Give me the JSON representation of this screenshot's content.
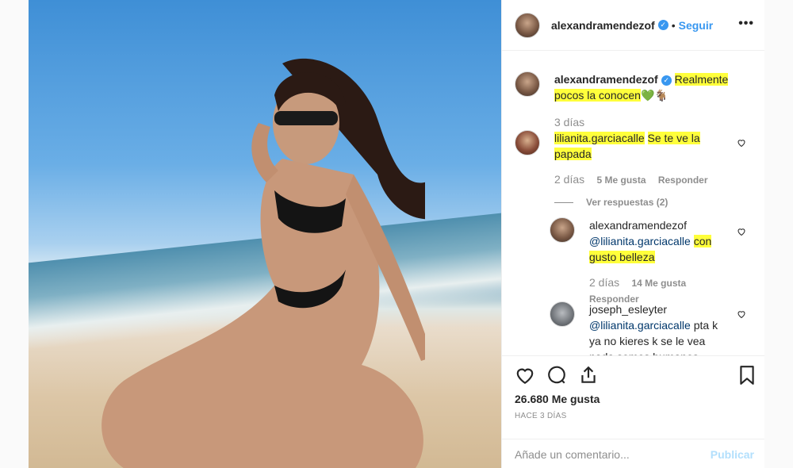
{
  "post": {
    "author": "alexandramendezof",
    "follow_label": "Seguir",
    "separator": "•",
    "more_label": "•••",
    "caption_text": "Realmente pocos la conocen",
    "caption_emoji": "💚🐐",
    "caption_time": "3 días"
  },
  "comments": [
    {
      "user": "lilianita.garciacalle",
      "text": "Se te ve la papada",
      "time": "2 días",
      "likes": "5 Me gusta",
      "reply_label": "Responder",
      "view_replies": "Ver respuestas (2)"
    },
    {
      "user": "alexandramendezof",
      "mention": "@lilianita.garciacalle",
      "text": "con gusto belleza",
      "time": "2 días",
      "likes": "14 Me gusta",
      "reply_label": "Responder"
    },
    {
      "user": "joseph_esleyter",
      "mention": "@lilianita.garciacalle",
      "text": "pta k ya no kieres k se le vea nada somos humanos"
    }
  ],
  "footer": {
    "likes_count": "26.680 Me gusta",
    "posted_ago": "HACE 3 DÍAS",
    "comment_placeholder": "Añade un comentario...",
    "post_button": "Publicar"
  },
  "icons": {
    "like": "heart-icon",
    "comment": "comment-icon",
    "share": "share-icon",
    "save": "bookmark-icon",
    "verified": "verified-badge-icon"
  },
  "colors": {
    "link": "#3897f0",
    "highlight": "#ffff3b",
    "muted": "#8e8e8e"
  }
}
